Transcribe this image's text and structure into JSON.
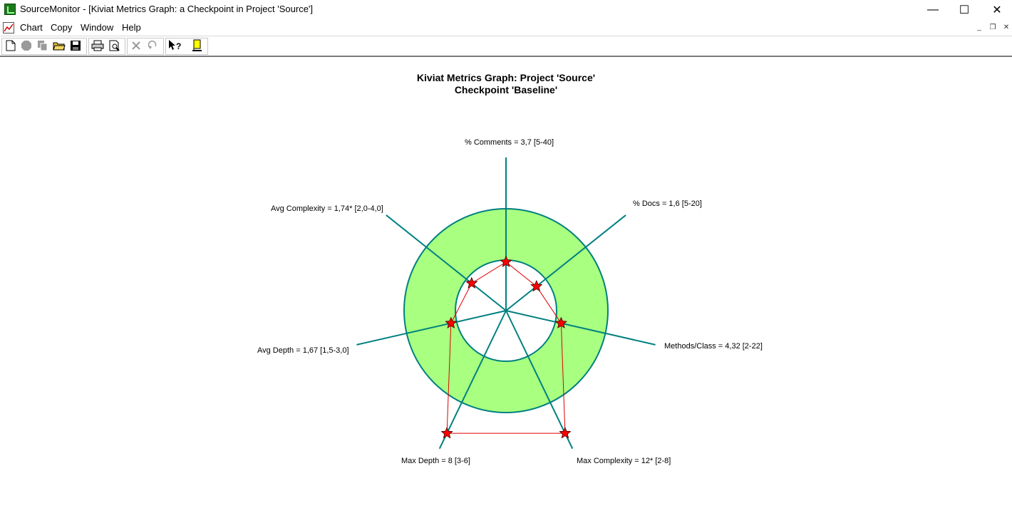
{
  "window": {
    "title": "SourceMonitor - [Kiviat Metrics Graph: a Checkpoint in Project 'Source']",
    "minimize_glyph": "—",
    "maximize_glyph": "☐",
    "close_glyph": "✕"
  },
  "menu": {
    "items": [
      "Chart",
      "Copy",
      "Window",
      "Help"
    ],
    "mdi_minimize": "_",
    "mdi_restore": "❐",
    "mdi_close": "✕"
  },
  "toolbar": {
    "buttons": [
      "new-document-icon",
      "stop-icon",
      "copy-icon",
      "open-folder-icon",
      "save-icon",
      "print-icon",
      "print-preview-icon",
      "delete-icon",
      "undo-icon",
      "context-help-icon",
      "bookmark-icon"
    ]
  },
  "chart": {
    "title_line1": "Kiviat Metrics Graph: Project 'Source'",
    "title_line2": "Checkpoint 'Baseline'"
  },
  "chart_data": {
    "type": "radar",
    "title": "Kiviat Metrics Graph: Project 'Source' Checkpoint 'Baseline'",
    "axes": [
      {
        "label": "% Comments = 3,7 [5-40]",
        "value": 3.7,
        "range": [
          5,
          40
        ]
      },
      {
        "label": "% Docs = 1,6 [5-20]",
        "value": 1.6,
        "range": [
          5,
          20
        ]
      },
      {
        "label": "Methods/Class = 4,32 [2-22]",
        "value": 4.32,
        "range": [
          2,
          22
        ]
      },
      {
        "label": "Max Complexity = 12* [2-8]",
        "value": 12,
        "range": [
          2,
          8
        ]
      },
      {
        "label": "Max Depth = 8 [3-6]",
        "value": 8,
        "range": [
          3,
          6
        ]
      },
      {
        "label": "Avg Depth = 1,67 [1,5-3,0]",
        "value": 1.67,
        "range": [
          1.5,
          3.0
        ]
      },
      {
        "label": "Avg Complexity = 1,74* [2,0-4,0]",
        "value": 1.74,
        "range": [
          2.0,
          4.0
        ]
      }
    ],
    "colors": {
      "band": "#a8ff80",
      "ring": "#008080",
      "axis": "#008080",
      "series_line": "#e00000",
      "marker": "#ff0000"
    }
  }
}
